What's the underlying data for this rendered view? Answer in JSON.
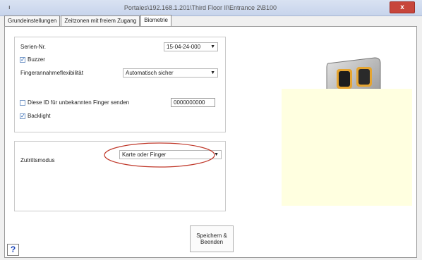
{
  "window": {
    "title": "Portales\\192.168.1.201\\Third Floor II\\Entrance 2\\B100",
    "close_label": "x"
  },
  "tabs": [
    {
      "label": "Grundeinstellungen"
    },
    {
      "label": "Zeitzonen mit freiem Zugang"
    },
    {
      "label": "Biometrie"
    }
  ],
  "settings": {
    "serial_label": "Serien-Nr.",
    "serial_value": "15-04-24-000",
    "buzzer_label": "Buzzer",
    "buzzer_checked": true,
    "sensitivity_label": "Fingerannahmeflexibilität",
    "sensitivity_value": "Automatisch sicher",
    "send_id_label": "Diese ID für unbekannten Finger senden",
    "send_id_checked": false,
    "send_id_value": "0000000000",
    "backlight_label": "Backlight",
    "backlight_checked": true
  },
  "access": {
    "mode_label": "Zutrittsmodus",
    "mode_value": "Karte oder Finger"
  },
  "actions": {
    "save_line1": "Speichern &",
    "save_line2": "Beenden",
    "help_label": "?"
  },
  "icons": {
    "device": "fingerprint-reader-device-image",
    "dropdown": "chevron-down-icon"
  },
  "colors": {
    "highlight_ellipse": "#c0392b",
    "preview_background": "#ffffe0"
  }
}
